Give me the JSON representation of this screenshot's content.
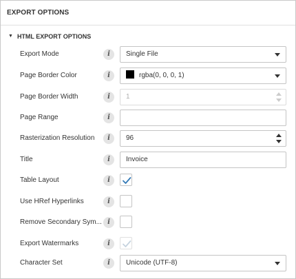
{
  "panel": {
    "title": "EXPORT OPTIONS",
    "group": {
      "caret": "▼",
      "title": "HTML EXPORT OPTIONS"
    }
  },
  "info_glyph": "i",
  "fields": {
    "export_mode": {
      "label": "Export Mode",
      "value": "Single File"
    },
    "page_border_color": {
      "label": "Page Border Color",
      "value": "rgba(0, 0, 0, 1)",
      "swatch_color": "#000000"
    },
    "page_border_width": {
      "label": "Page Border Width",
      "value": "1",
      "disabled": true
    },
    "page_range": {
      "label": "Page Range",
      "value": ""
    },
    "rasterization_resolution": {
      "label": "Rasterization Resolution",
      "value": "96"
    },
    "title": {
      "label": "Title",
      "value": "Invoice"
    },
    "table_layout": {
      "label": "Table Layout",
      "checked": true
    },
    "use_href_hyperlinks": {
      "label": "Use HRef Hyperlinks",
      "checked": false
    },
    "remove_secondary_symbols": {
      "label": "Remove Secondary Sym...",
      "checked": false
    },
    "export_watermarks": {
      "label": "Export Watermarks",
      "checked": true,
      "disabled": true
    },
    "character_set": {
      "label": "Character Set",
      "value": "Unicode (UTF-8)"
    }
  },
  "colors": {
    "check_active": "#337ab7",
    "check_disabled": "#c6d3df"
  }
}
